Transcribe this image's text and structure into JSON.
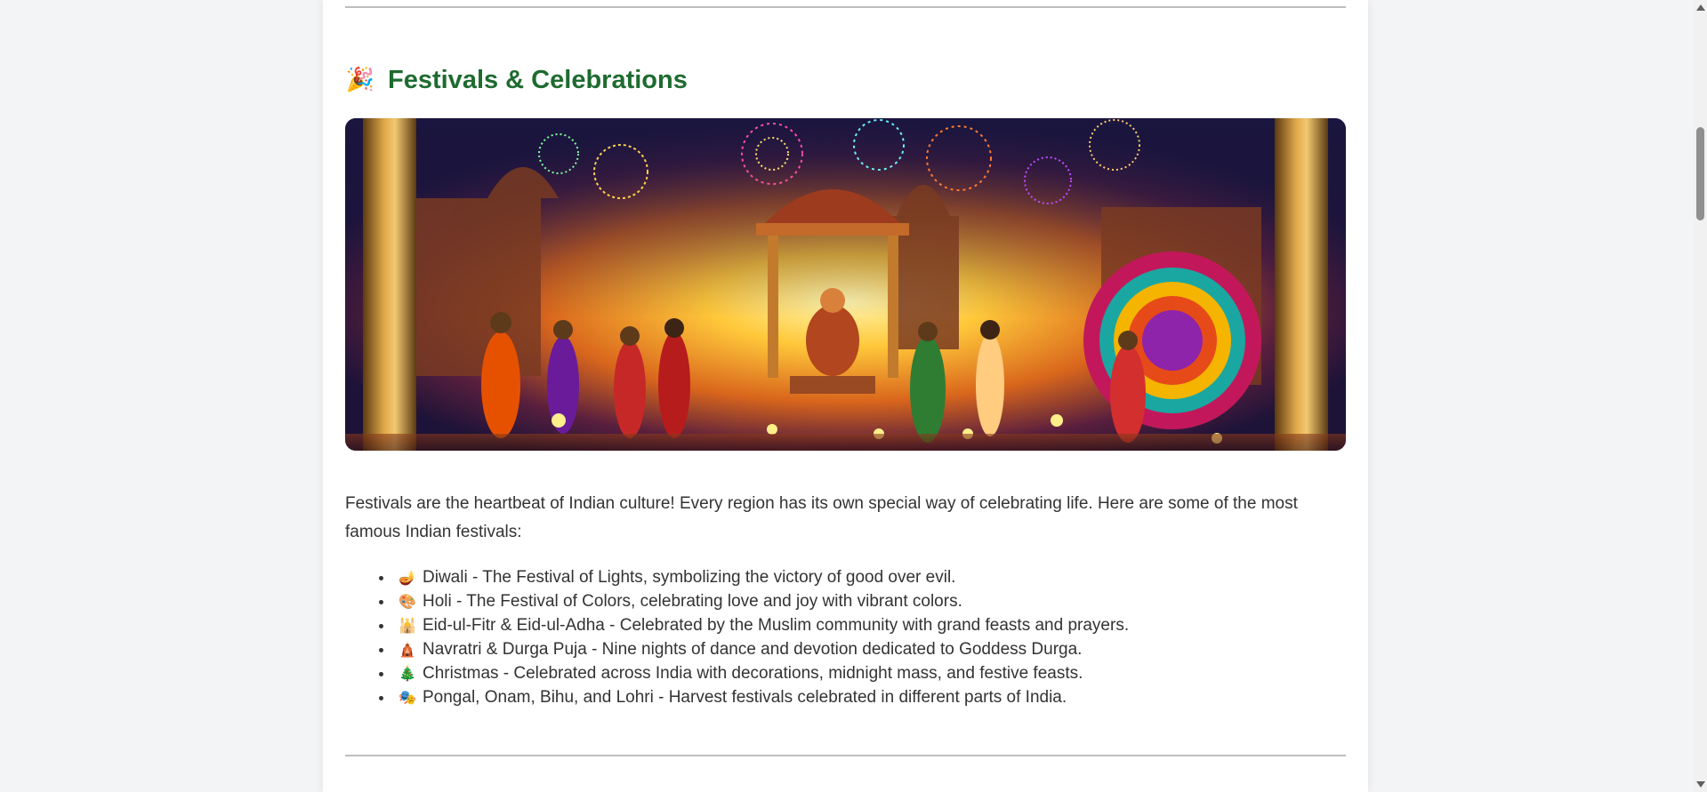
{
  "section": {
    "emoji": "🎉",
    "title": "Festivals & Celebrations",
    "image_alt": "Illustration of an Indian festival celebration with fireworks, lamps and people in traditional dress",
    "intro": "Festivals are the heartbeat of Indian culture! Every region has its own special way of celebrating life. Here are some of the most famous Indian festivals:",
    "festivals": [
      {
        "emoji": "🪔",
        "text": "Diwali - The Festival of Lights, symbolizing the victory of good over evil."
      },
      {
        "emoji": "🎨",
        "text": "Holi - The Festival of Colors, celebrating love and joy with vibrant colors."
      },
      {
        "emoji": "🕌",
        "text": "Eid-ul-Fitr & Eid-ul-Adha - Celebrated by the Muslim community with grand feasts and prayers."
      },
      {
        "emoji": "🛕",
        "text": "Navratri & Durga Puja - Nine nights of dance and devotion dedicated to Goddess Durga."
      },
      {
        "emoji": "🎄",
        "text": "Christmas - Celebrated across India with decorations, midnight mass, and festive feasts."
      },
      {
        "emoji": "🎭",
        "text": "Pongal, Onam, Bihu, and Lohri - Harvest festivals celebrated in different parts of India."
      }
    ]
  },
  "colors": {
    "heading": "#1e6b2f",
    "body_text": "#333333",
    "page_bg": "#f3f4f6",
    "card_bg": "#ffffff",
    "divider": "#bdbdbd"
  }
}
